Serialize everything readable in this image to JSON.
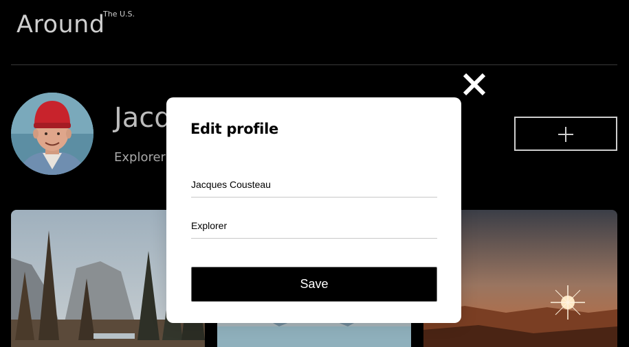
{
  "header": {
    "logo": "Around",
    "logo_sub": "The U.S."
  },
  "profile": {
    "name": "Jacques Cousteau",
    "about": "Explorer",
    "avatar_icon": "avatar-photo",
    "add_icon": "plus-icon"
  },
  "cards": [
    {
      "image": "yosemite-valley"
    },
    {
      "image": "lake-louise"
    },
    {
      "image": "bald-mountains-sunset"
    }
  ],
  "modal": {
    "title": "Edit profile",
    "name_value": "Jacques Cousteau",
    "about_value": "Explorer",
    "save_label": "Save",
    "close_icon": "close-icon"
  },
  "colors": {
    "background": "#000000",
    "modal_bg": "#ffffff",
    "button_bg": "#000000",
    "button_text": "#ffffff"
  }
}
